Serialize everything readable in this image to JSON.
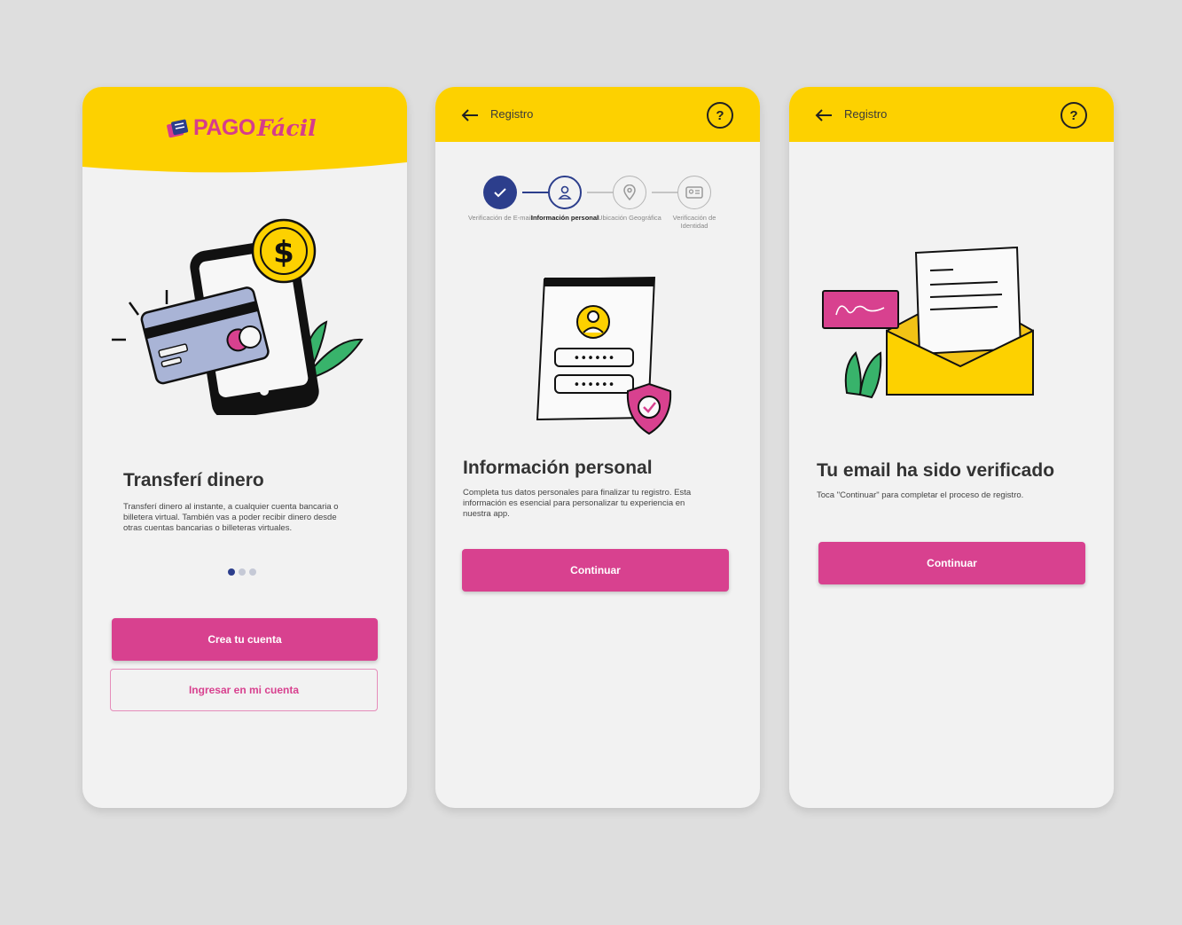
{
  "colors": {
    "brand_yellow": "#fdd100",
    "brand_pink": "#d8418f",
    "brand_navy": "#2c3e8c",
    "background": "#dedede",
    "screen": "#f2f2f2"
  },
  "screen1": {
    "logo": {
      "pago": "PAGO",
      "facil": "Fácil"
    },
    "title": "Transferí dinero",
    "description": "Transferí dinero al instante, a cualquier cuenta bancaria o billetera virtual. También vas a poder recibir dinero desde otras cuentas bancarias o billeteras virtuales.",
    "carousel": {
      "total": 3,
      "active_index": 1
    },
    "primary_button": "Crea tu cuenta",
    "secondary_button": "Ingresar en mi cuenta"
  },
  "screen2": {
    "header": {
      "title": "Registro",
      "back_icon": "arrow-left-icon",
      "help_icon": "question-mark-icon",
      "help_glyph": "?"
    },
    "steps": [
      {
        "label": "Verificación de E-mail",
        "state": "done",
        "icon": "check-icon"
      },
      {
        "label": "Información personal",
        "state": "current",
        "icon": "user-icon"
      },
      {
        "label": "Ubicación Geográfica",
        "state": "todo",
        "icon": "location-pin-icon"
      },
      {
        "label": "Verificación de Identidad",
        "state": "todo",
        "icon": "id-card-icon"
      }
    ],
    "title": "Información personal",
    "description": "Completa tus datos personales para finalizar tu registro. Esta información es esencial para personalizar tu experiencia en nuestra app.",
    "password_mask": "••••••",
    "primary_button": "Continuar"
  },
  "screen3": {
    "header": {
      "title": "Registro",
      "back_icon": "arrow-left-icon",
      "help_icon": "question-mark-icon",
      "help_glyph": "?"
    },
    "title": "Tu email ha sido verificado",
    "description": "Toca \"Continuar\" para completar el proceso de registro.",
    "primary_button": "Continuar"
  }
}
